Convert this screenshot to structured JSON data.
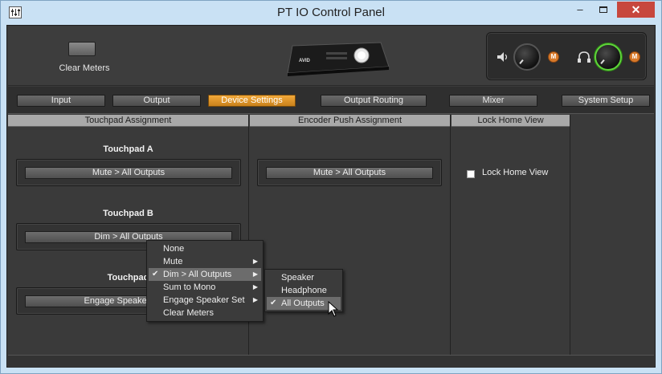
{
  "window": {
    "title": "PT IO Control Panel",
    "minimize_label": "–",
    "close_label": "✕"
  },
  "header": {
    "clear_meters_label": "Clear Meters",
    "device_logo_text": "AVID",
    "speaker_mute_label": "M",
    "headphone_mute_label": "M"
  },
  "tabs": [
    {
      "label": "Input"
    },
    {
      "label": "Output"
    },
    {
      "label": "Device Settings"
    },
    {
      "label": "Output Routing"
    },
    {
      "label": "Mixer"
    },
    {
      "label": "System Setup"
    }
  ],
  "panels": {
    "touchpad": {
      "header": "Touchpad Assignment",
      "touchpad_a": {
        "label": "Touchpad A",
        "value": "Mute > All Outputs"
      },
      "touchpad_b": {
        "label": "Touchpad B",
        "value": "Dim > All Outputs"
      },
      "touchpad_c": {
        "label": "Touchpad",
        "value": "Engage Speaker Set >"
      }
    },
    "encoder": {
      "header": "Encoder Push Assignment",
      "value": "Mute > All Outputs"
    },
    "lock": {
      "header": "Lock Home View",
      "checkbox_label": "Lock Home View",
      "checked": false
    }
  },
  "context_menu": {
    "items": [
      {
        "label": "None",
        "check": "",
        "arrow": ""
      },
      {
        "label": "Mute",
        "check": "",
        "arrow": "▶"
      },
      {
        "label": "Dim > All Outputs",
        "check": "✔",
        "arrow": "▶"
      },
      {
        "label": "Sum to Mono",
        "check": "",
        "arrow": "▶"
      },
      {
        "label": "Engage Speaker Set",
        "check": "",
        "arrow": "▶"
      },
      {
        "label": "Clear Meters",
        "check": "",
        "arrow": ""
      }
    ],
    "highlighted_index": 2
  },
  "submenu": {
    "items": [
      {
        "label": "Speaker",
        "check": ""
      },
      {
        "label": "Headphone",
        "check": ""
      },
      {
        "label": "All Outputs",
        "check": "✔"
      }
    ],
    "highlighted_index": 2
  },
  "colors": {
    "active_tab": "#e89a2a",
    "mute_button": "#d87a2a",
    "headphone_ring": "#5fd33a"
  }
}
